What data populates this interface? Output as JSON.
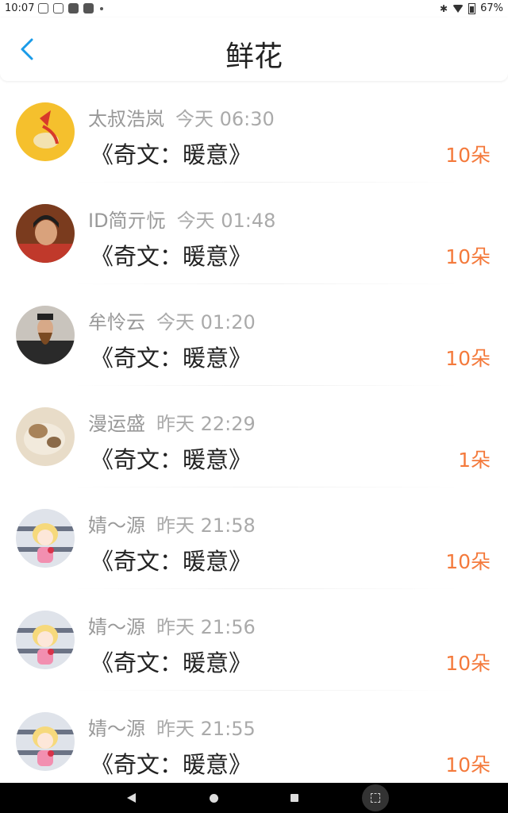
{
  "status_bar": {
    "time": "10:07",
    "battery": "67%",
    "icons": [
      "notification-icon",
      "weibo-icon",
      "app-icon",
      "app-icon",
      "dot-icon",
      "bluetooth-icon",
      "wifi-icon",
      "battery-icon"
    ]
  },
  "header": {
    "title": "鲜花",
    "back_icon": "chevron-left-icon",
    "accent": "#1a9be8"
  },
  "records": [
    {
      "name": "太叔浩岚",
      "time": "今天 06:30",
      "work": "《奇文：暖意》",
      "count": "10朵"
    },
    {
      "name": "ID简亓忨",
      "time": "今天 01:48",
      "work": "《奇文：暖意》",
      "count": "10朵"
    },
    {
      "name": "牟怜云",
      "time": "今天 01:20",
      "work": "《奇文：暖意》",
      "count": "10朵"
    },
    {
      "name": "漫运盛",
      "time": "昨天 22:29",
      "work": "《奇文：暖意》",
      "count": "1朵"
    },
    {
      "name": "婧～源",
      "time": "昨天 21:58",
      "work": "《奇文：暖意》",
      "count": "10朵"
    },
    {
      "name": "婧～源",
      "time": "昨天 21:56",
      "work": "《奇文：暖意》",
      "count": "10朵"
    },
    {
      "name": "婧～源",
      "time": "昨天 21:55",
      "work": "《奇文：暖意》",
      "count": "10朵"
    }
  ],
  "colors": {
    "count": "#f47a3c",
    "name": "#999999",
    "work": "#222222"
  },
  "nav_bar": {
    "icons": [
      "back-triangle-icon",
      "home-circle-icon",
      "recents-square-icon",
      "screenshot-icon"
    ]
  }
}
